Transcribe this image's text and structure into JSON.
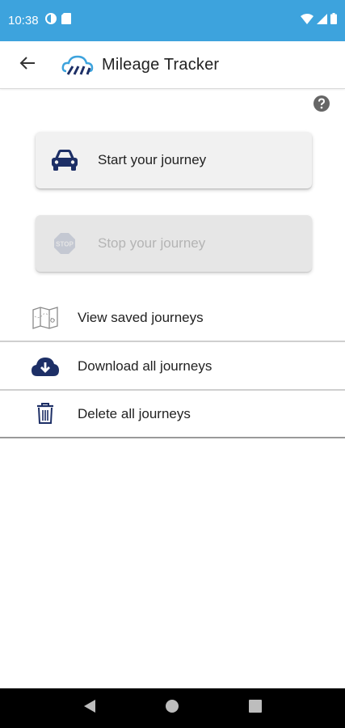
{
  "status_bar": {
    "time": "10:38",
    "icons": [
      "data-saver-icon",
      "sd-card-icon",
      "wifi-icon",
      "signal-icon",
      "battery-icon"
    ]
  },
  "app_bar": {
    "title": "Mileage Tracker",
    "back_icon": "arrow-left-icon",
    "logo_icon": "cloud-road-logo-icon"
  },
  "help": {
    "icon": "help-circle-icon"
  },
  "journey_actions": {
    "start": {
      "label": "Start your journey",
      "icon": "car-icon",
      "enabled": true
    },
    "stop": {
      "label": "Stop your journey",
      "icon": "stop-sign-icon",
      "enabled": false
    }
  },
  "menu": {
    "items": [
      {
        "label": "View saved journeys",
        "icon": "map-icon"
      },
      {
        "label": "Download all journeys",
        "icon": "cloud-download-icon"
      },
      {
        "label": "Delete all journeys",
        "icon": "trash-icon"
      }
    ]
  },
  "colors": {
    "status_bar": "#3da3dd",
    "accent_navy": "#1d2f66",
    "card_bg": "#f1f1f1",
    "disabled_text": "#b4b4b4"
  },
  "nav_bar": {
    "buttons": [
      "back-triangle-icon",
      "home-circle-icon",
      "recents-square-icon"
    ]
  }
}
